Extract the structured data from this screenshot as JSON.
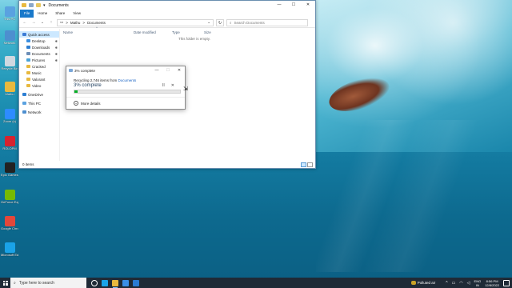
{
  "desktop": {
    "icons": [
      {
        "label": "This PC",
        "icon": "this-pc-icon",
        "color": "#5aa2e0"
      },
      {
        "label": "Network",
        "icon": "network-icon",
        "color": "#4d8fcf"
      },
      {
        "label": "Recycle Bin",
        "icon": "recycle-bin-icon",
        "color": "#cfd8e0"
      },
      {
        "label": "Mathu",
        "icon": "user-folder-icon",
        "color": "#e8b93f"
      },
      {
        "label": "Zoom (x)",
        "icon": "zoom-icon",
        "color": "#2d8cff"
      },
      {
        "label": "ROLOPM",
        "icon": "app-icon",
        "color": "#d6232f"
      },
      {
        "label": "Epic Games Launcher",
        "icon": "epic-games-icon",
        "color": "#222222"
      },
      {
        "label": "GeForce Experience",
        "icon": "geforce-icon",
        "color": "#76b900"
      },
      {
        "label": "Google Chrome",
        "icon": "chrome-icon",
        "color": "#e4473a"
      },
      {
        "label": "Microsoft Edge",
        "icon": "edge-icon",
        "color": "#1aa3e8"
      }
    ]
  },
  "explorer": {
    "title": "Documents",
    "ribbon_tabs": [
      "File",
      "Home",
      "Share",
      "View"
    ],
    "address": {
      "root": "Mathu",
      "current": "Documents",
      "separator": ">"
    },
    "search_placeholder": "Search Documents",
    "nav": [
      {
        "label": "Quick access",
        "icon": "star-icon",
        "color": "#3b7bd6",
        "selected": true,
        "sub": false,
        "pinned": false
      },
      {
        "label": "Desktop",
        "icon": "desktop-icon",
        "color": "#3b8fe0",
        "sub": true,
        "pinned": true
      },
      {
        "label": "Downloads",
        "icon": "downloads-icon",
        "color": "#2f7fd1",
        "sub": true,
        "pinned": true
      },
      {
        "label": "Documents",
        "icon": "documents-icon",
        "color": "#6d8fb8",
        "sub": true,
        "pinned": true
      },
      {
        "label": "Pictures",
        "icon": "pictures-icon",
        "color": "#4aa3d8",
        "sub": true,
        "pinned": true
      },
      {
        "label": "Cracked",
        "icon": "folder-icon",
        "color": "#e8b93f",
        "sub": true,
        "pinned": false
      },
      {
        "label": "Music",
        "icon": "music-icon",
        "color": "#e8b93f",
        "sub": true,
        "pinned": false
      },
      {
        "label": "Valorant",
        "icon": "folder-icon",
        "color": "#e8b93f",
        "sub": true,
        "pinned": false
      },
      {
        "label": "Video",
        "icon": "folder-icon",
        "color": "#e8b93f",
        "sub": true,
        "pinned": false
      },
      {
        "label": "OneDrive",
        "icon": "onedrive-icon",
        "color": "#2d7fd3",
        "sub": false,
        "gap": true
      },
      {
        "label": "This PC",
        "icon": "this-pc-icon",
        "color": "#5aa2e0",
        "sub": false,
        "gap": true
      },
      {
        "label": "Network",
        "icon": "network-icon",
        "color": "#4d8fcf",
        "sub": false,
        "gap": true
      }
    ],
    "columns": [
      "Name",
      "Date modified",
      "Type",
      "Size"
    ],
    "empty_text": "This folder is empty.",
    "status": "0 items"
  },
  "dialog": {
    "title": "3% complete",
    "line_prefix": "Recycling 2,746 items from",
    "line_link": "Documents",
    "percent_text": "3% complete",
    "progress": 0.03,
    "more_details": "More details",
    "pause_symbol": "II",
    "close_symbol": "✕",
    "progress_color": "#06b025"
  },
  "taskbar": {
    "search_placeholder": "Type here to search",
    "weather": "Polluted air",
    "lang_top": "ENG",
    "lang_bottom": "IN",
    "time": "8:56 PM",
    "date": "12/8/2022",
    "apps": [
      {
        "icon": "task-view-icon",
        "color": "#ffffff",
        "active": false
      },
      {
        "icon": "edge-icon",
        "color": "#1aa3e8",
        "active": false
      },
      {
        "icon": "file-explorer-icon",
        "color": "#e8b93f",
        "active": true
      },
      {
        "icon": "store-icon",
        "color": "#3a8ee6",
        "active": false
      },
      {
        "icon": "mail-icon",
        "color": "#2a7bd3",
        "active": false
      }
    ]
  }
}
